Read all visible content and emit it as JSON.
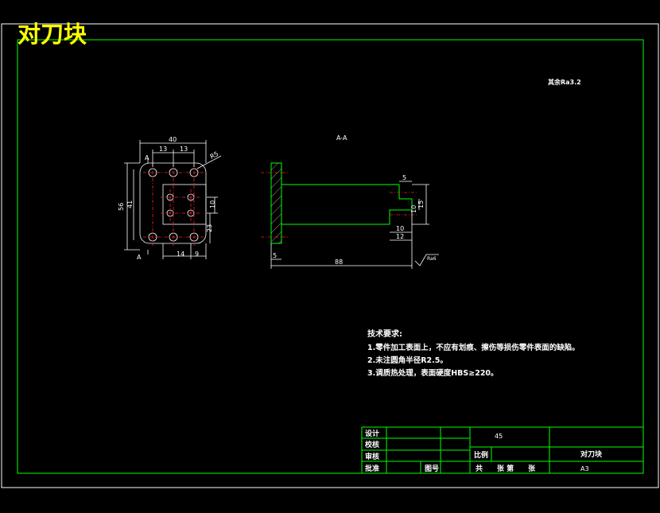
{
  "title": "对刀块",
  "roughness_note": "其余Ra3.2",
  "section_label": "A-A",
  "view_markers": {
    "left_top": "A",
    "left_bottom": "A"
  },
  "dimensions": {
    "width_40": "40",
    "pitch_13a": "13",
    "pitch_13b": "13",
    "radius": "R5",
    "height_56": "56",
    "height_41": "41",
    "d_10": "10",
    "d_23": "23",
    "d_14": "14",
    "d_9": "9",
    "d_5_top": "5",
    "d_15": "15",
    "d_10_side": "10",
    "d_10_bottom": "10",
    "d_12": "12",
    "d_5_left": "5",
    "length_88": "88",
    "ra_small": "Ra6"
  },
  "tech_requirements": {
    "heading": "技术要求:",
    "items": [
      "1.零件加工表面上，不应有划痕、擦伤等损伤零件表面的缺陷。",
      "2.未注圆角半径R2.5。",
      "3.调质热处理，表面硬度HBS≥220。"
    ]
  },
  "title_block": {
    "design": "设计",
    "check": "校核",
    "review": "审核",
    "approve": "批准",
    "drawing_no": "图号",
    "material": "45",
    "scale": "比例",
    "sheets": "共　　张 第　　张",
    "part_name": "对刀块",
    "paper_size": "A3"
  },
  "colors": {
    "background": "#000000",
    "frame": "#00ff00",
    "lines": "#ffffff",
    "centerlines": "#ff2020",
    "title_text": "#ffff00"
  }
}
